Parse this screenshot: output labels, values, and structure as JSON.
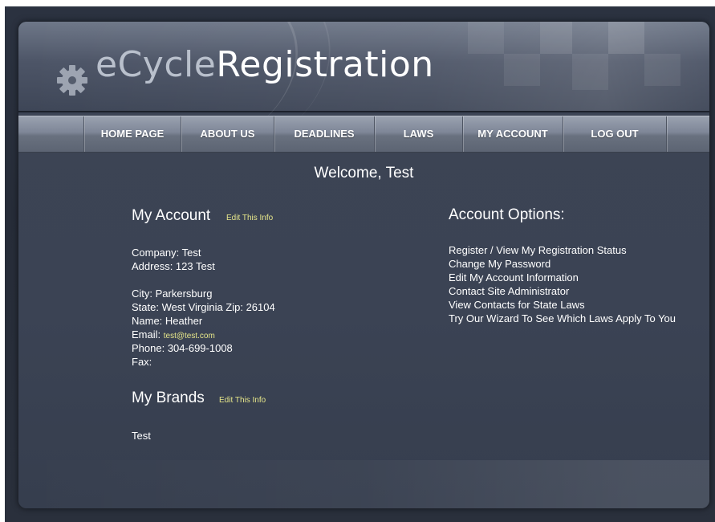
{
  "logo": {
    "part1": "eCycle",
    "part2": "Registration",
    "icon": "gear-icon"
  },
  "nav": [
    "HOME PAGE",
    "ABOUT US",
    "DEADLINES",
    "LAWS",
    "MY ACCOUNT",
    "LOG OUT"
  ],
  "welcome": "Welcome, Test",
  "account": {
    "title": "My Account",
    "edit_label": "Edit This Info",
    "company": "Company: Test",
    "address": "Address: 123 Test",
    "city": "City: Parkersburg",
    "state_zip": "State: West Virginia Zip: 26104",
    "name": "Name: Heather",
    "email_label": "Email:",
    "email_value": "test@test.com",
    "phone": "Phone: 304-699-1008",
    "fax": "Fax:"
  },
  "brands": {
    "title": "My Brands",
    "edit_label": "Edit This Info",
    "items": [
      "Test"
    ]
  },
  "options": {
    "title": "Account Options:",
    "links": [
      "Register / View My Registration Status",
      "Change My Password",
      "Edit My Account Information",
      "Contact Site Administrator",
      "View Contacts for State Laws",
      "Try Our Wizard To See Which Laws Apply To You"
    ]
  },
  "colors": {
    "link_yellow": "#e6e68a",
    "background": "#3b4354"
  }
}
